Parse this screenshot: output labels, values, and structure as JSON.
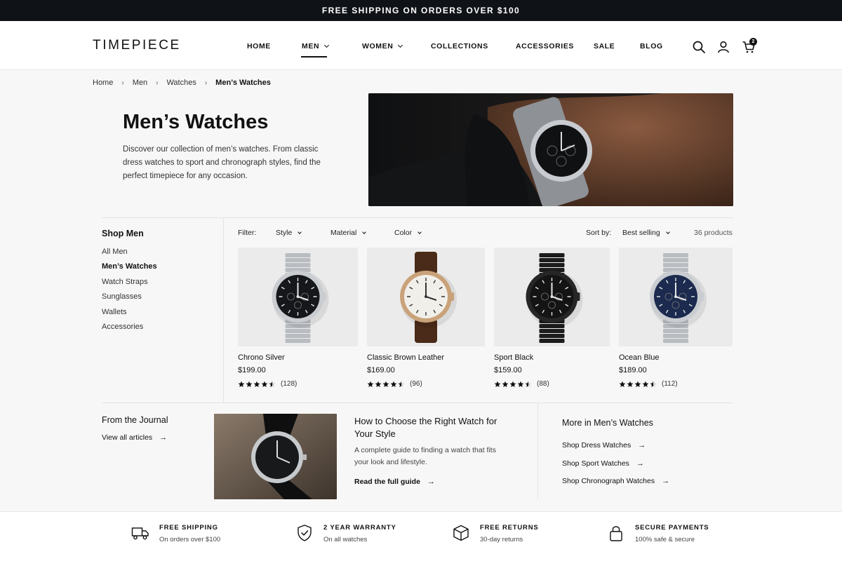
{
  "announcement": "FREE SHIPPING ON ORDERS OVER $100",
  "header": {
    "logo": "TIMEPIECE",
    "nav": [
      "HOME",
      "MEN",
      "WOMEN",
      "COLLECTIONS",
      "ACCESSORIES",
      "SALE",
      "BLOG"
    ],
    "active_nav": "MEN",
    "cart_count": "2",
    "icons": [
      "search-icon",
      "user-icon",
      "cart-icon"
    ]
  },
  "breadcrumb": [
    "Home",
    "Men",
    "Watches",
    "Men’s Watches"
  ],
  "hero": {
    "title": "Men’s Watches",
    "description": "Discover our collection of men’s watches. From classic dress watches to sport and chronograph styles, find the perfect timepiece for any occasion."
  },
  "sidebar": {
    "title": "Shop Men",
    "items": [
      "All Men",
      "Men’s Watches",
      "Watch Straps",
      "Sunglasses",
      "Wallets",
      "Accessories"
    ],
    "active": "Men’s Watches"
  },
  "filters": {
    "label": "Filter:",
    "options": [
      "Style",
      "Material",
      "Color"
    ],
    "sort_label": "Sort by:",
    "sort_value": "Best selling",
    "count": "36 products"
  },
  "products": [
    {
      "name": "Chrono Silver",
      "price": "$199.00",
      "reviews": "(128)",
      "rating": 4.5,
      "dial": "#15171a",
      "band": "#b9bcc0",
      "case": "#c9ccd0"
    },
    {
      "name": "Classic Brown Leather",
      "price": "$169.00",
      "reviews": "(96)",
      "rating": 4.5,
      "dial": "#f1efea",
      "band": "#4a2a18",
      "case": "#c9a27a"
    },
    {
      "name": "Sport Black",
      "price": "$159.00",
      "reviews": "(88)",
      "rating": 4.5,
      "dial": "#141414",
      "band": "#1c1c1c",
      "case": "#262626"
    },
    {
      "name": "Ocean Blue",
      "price": "$189.00",
      "reviews": "(112)",
      "rating": 4.5,
      "dial": "#1b2a4e",
      "band": "#b9bcc0",
      "case": "#c9ccd0"
    }
  ],
  "journal": {
    "title": "From the Journal",
    "link": "View all articles",
    "article_title": "How to Choose the Right Watch for Your Style",
    "article_desc": "A complete guide to finding a watch that fits your look and lifestyle.",
    "article_link": "Read the full guide"
  },
  "more": {
    "title": "More in Men’s Watches",
    "links": [
      "Shop Dress Watches",
      "Shop Sport Watches",
      "Shop Chronograph Watches"
    ]
  },
  "features": [
    {
      "title": "FREE SHIPPING",
      "sub": "On orders over $100",
      "icon": "truck-icon"
    },
    {
      "title": "2 YEAR WARRANTY",
      "sub": "On all watches",
      "icon": "shield-icon"
    },
    {
      "title": "FREE RETURNS",
      "sub": "30-day returns",
      "icon": "box-icon"
    },
    {
      "title": "SECURE PAYMENTS",
      "sub": "100% safe & secure",
      "icon": "lock-icon"
    }
  ]
}
